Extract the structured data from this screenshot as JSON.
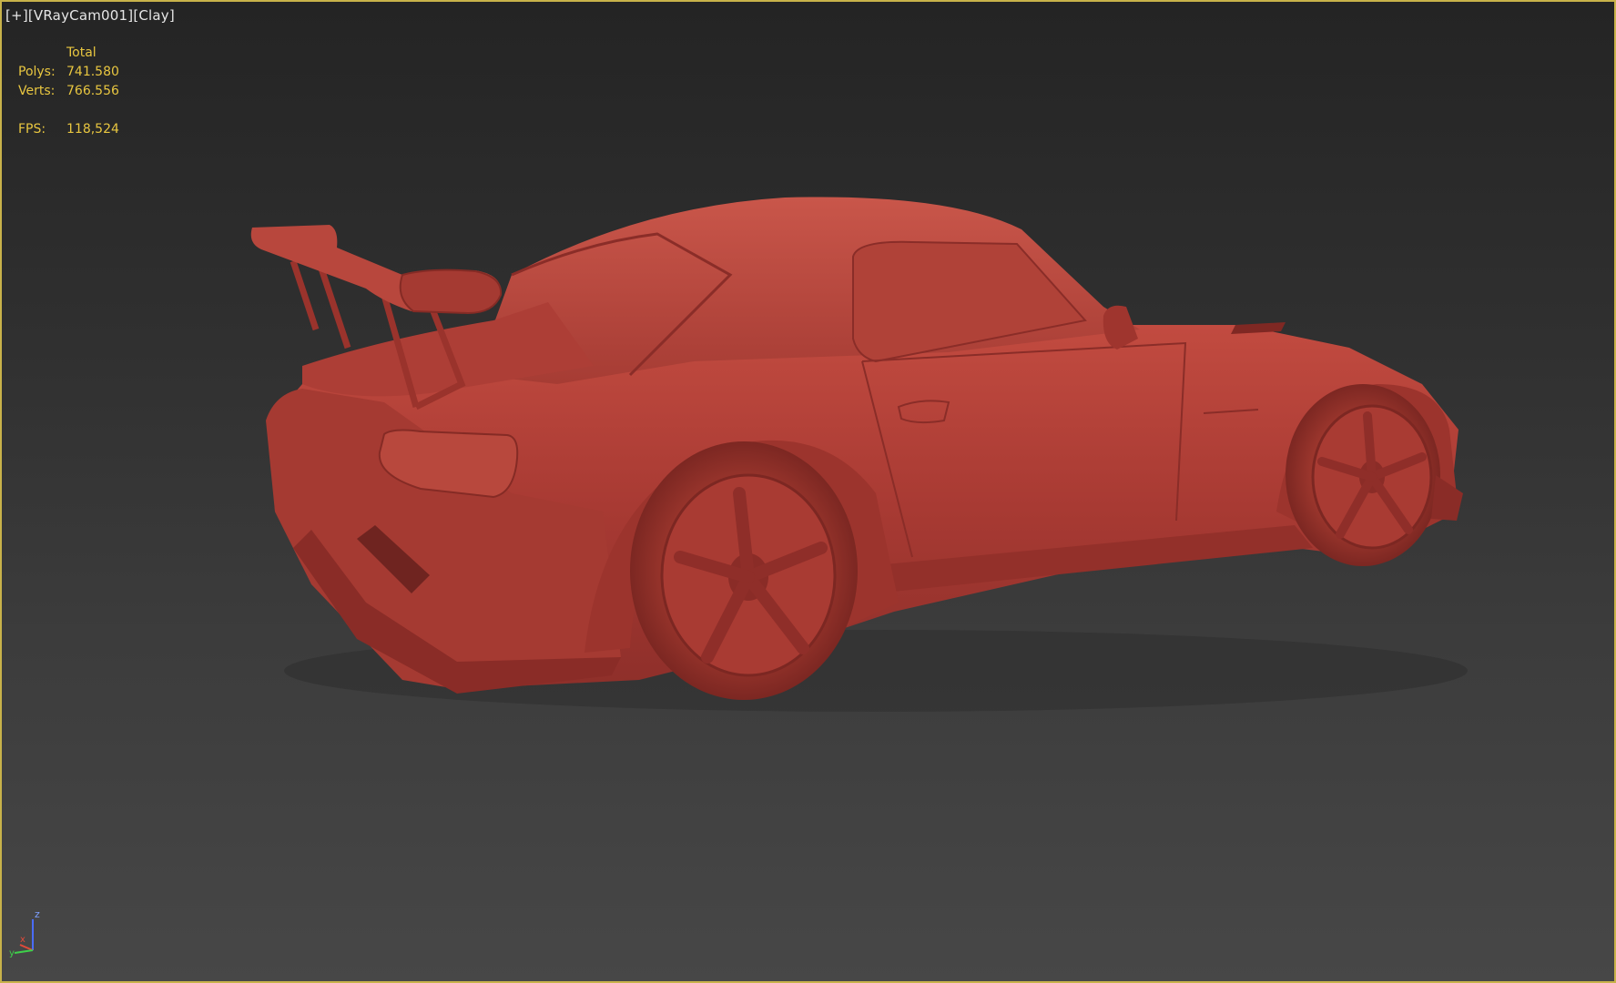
{
  "viewport": {
    "label_parts": [
      "[+]",
      "[VRayCam001]",
      "[Clay]"
    ],
    "border_color": "#c8b24a"
  },
  "stats": {
    "header": "Total",
    "polys_label": "Polys:",
    "polys_value": "741.580",
    "verts_label": "Verts:",
    "verts_value": "766.556",
    "fps_label": "FPS:",
    "fps_value": "118,524",
    "text_color": "#e8c640"
  },
  "scene": {
    "clay_color": "#b8433a"
  },
  "gizmo": {
    "axis_z": "z",
    "axis_x": "x",
    "axis_y": "y"
  }
}
